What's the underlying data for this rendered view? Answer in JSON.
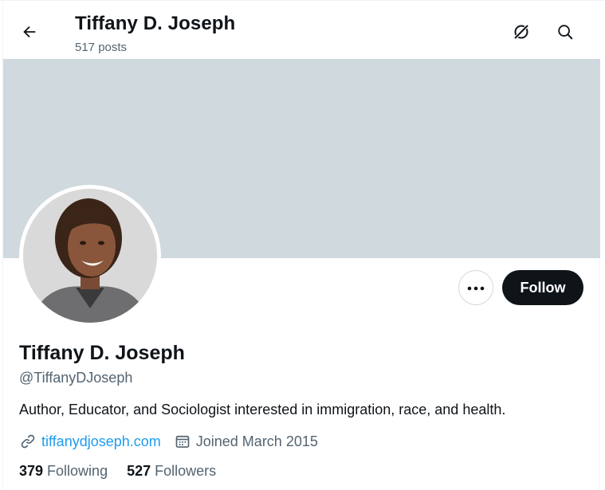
{
  "header": {
    "back_icon": "arrow-left-icon",
    "title": "Tiffany D. Joseph",
    "post_count": "517 posts",
    "grok_icon": "grok-icon",
    "search_icon": "search-icon"
  },
  "profile": {
    "banner_color": "#cfd9de",
    "name": "Tiffany D. Joseph",
    "handle": "@TiffanyDJoseph",
    "bio": "Author, Educator, and Sociologist interested in immigration, race, and health.",
    "website": "tiffanydjoseph.com",
    "joined": "Joined March 2015",
    "following_count": "379",
    "following_label": "Following",
    "followers_count": "527",
    "followers_label": "Followers"
  },
  "actions": {
    "more_icon": "more-dots-icon",
    "follow_label": "Follow"
  },
  "colors": {
    "accent": "#1d9bf0",
    "text_primary": "#0f1419",
    "text_secondary": "#536471",
    "follow_bg": "#0f1419"
  }
}
